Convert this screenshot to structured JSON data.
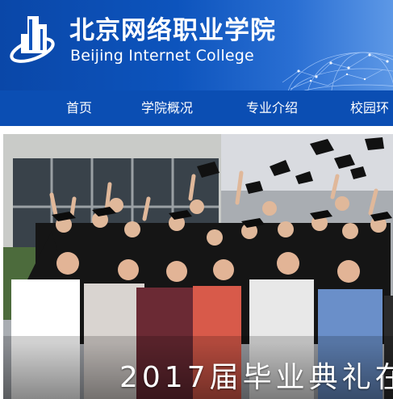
{
  "site": {
    "name_cn": "北京网络职业学院",
    "name_en": "Beijing Internet College",
    "brand_color": "#0b4eb3"
  },
  "nav": {
    "items": [
      {
        "label": "首页"
      },
      {
        "label": "学院概况"
      },
      {
        "label": "专业介绍"
      },
      {
        "label": "校园环"
      }
    ]
  },
  "banner": {
    "caption": "2017届毕业典礼在"
  }
}
